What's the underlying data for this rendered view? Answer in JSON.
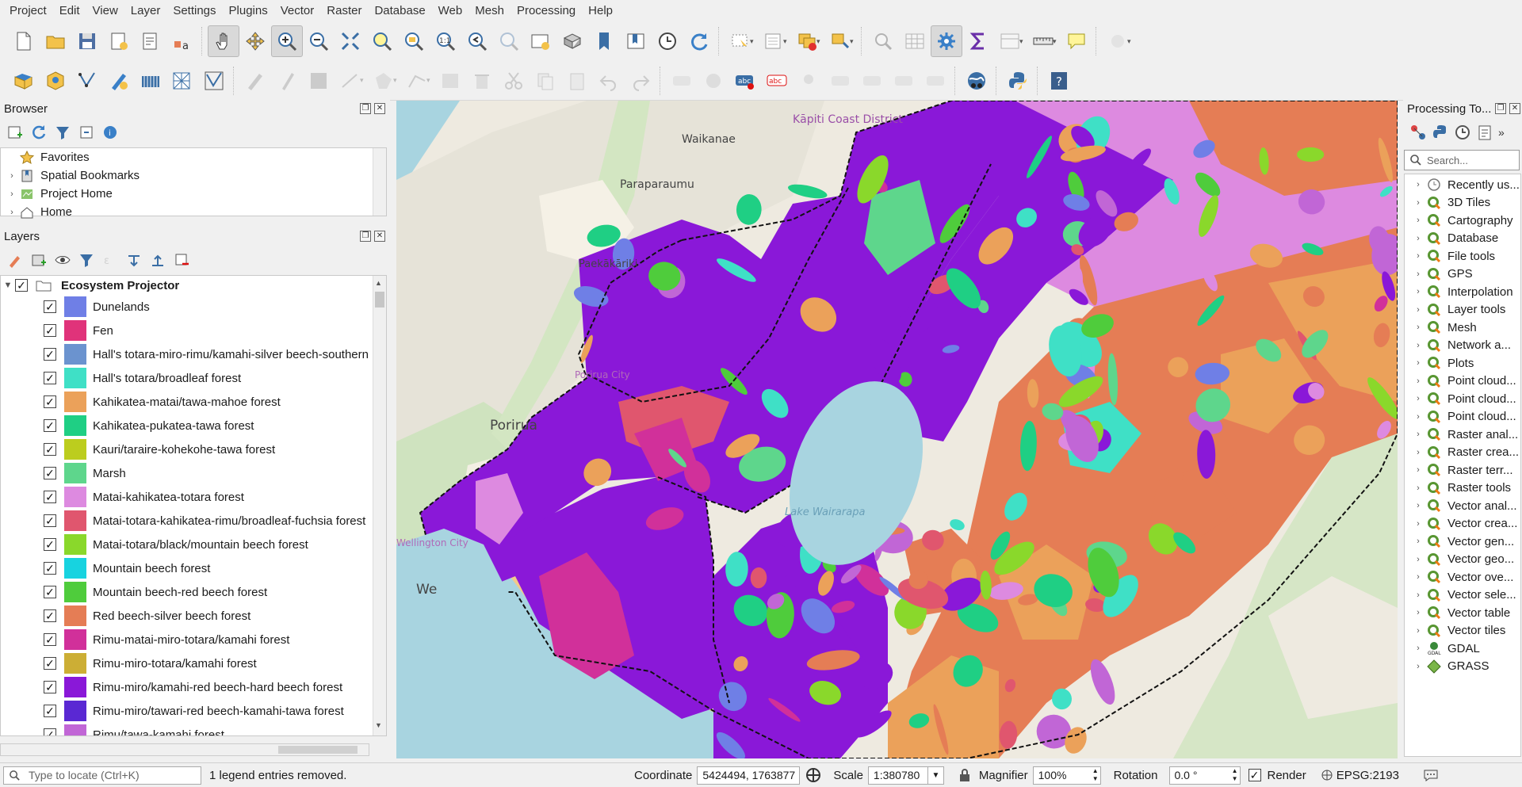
{
  "menu": [
    "Project",
    "Edit",
    "View",
    "Layer",
    "Settings",
    "Plugins",
    "Vector",
    "Raster",
    "Database",
    "Web",
    "Mesh",
    "Processing",
    "Help"
  ],
  "browser": {
    "title": "Browser",
    "items": [
      {
        "label": "Favorites",
        "icon": "star-icon"
      },
      {
        "label": "Spatial Bookmarks",
        "icon": "bookmark-icon"
      },
      {
        "label": "Project Home",
        "icon": "project-home-icon"
      },
      {
        "label": "Home",
        "icon": "home-icon"
      }
    ]
  },
  "layers": {
    "title": "Layers",
    "group": "Ecosystem Projector",
    "items": [
      {
        "label": "Dunelands",
        "color": "#6f7fe6"
      },
      {
        "label": "Fen",
        "color": "#e0337a"
      },
      {
        "label": "Hall's totara-miro-rimu/kamahi-silver beech-southern",
        "color": "#6b93cf"
      },
      {
        "label": "Hall's totara/broadleaf forest",
        "color": "#3fe0c6"
      },
      {
        "label": "Kahikatea-matai/tawa-mahoe forest",
        "color": "#eba15a"
      },
      {
        "label": "Kahikatea-pukatea-tawa forest",
        "color": "#1fcf84"
      },
      {
        "label": "Kauri/taraire-kohekohe-tawa forest",
        "color": "#bccd1e"
      },
      {
        "label": "Marsh",
        "color": "#5ed68c"
      },
      {
        "label": "Matai-kahikatea-totara forest",
        "color": "#dd8ae0"
      },
      {
        "label": "Matai-totara-kahikatea-rimu/broadleaf-fuchsia forest",
        "color": "#e0566e"
      },
      {
        "label": "Matai-totara/black/mountain beech forest",
        "color": "#8ad82b"
      },
      {
        "label": "Mountain beech forest",
        "color": "#17d3e0"
      },
      {
        "label": "Mountain beech-red beech forest",
        "color": "#4fcc3c"
      },
      {
        "label": "Red beech-silver beech forest",
        "color": "#e57d55"
      },
      {
        "label": "Rimu-matai-miro-totara/kamahi forest",
        "color": "#d1309a"
      },
      {
        "label": "Rimu-miro-totara/kamahi forest",
        "color": "#ccae35"
      },
      {
        "label": "Rimu-miro/kamahi-red beech-hard beech forest",
        "color": "#8a18d8"
      },
      {
        "label": "Rimu-miro/tawari-red beech-kamahi-tawa forest",
        "color": "#5a28d3"
      },
      {
        "label": "Rimu/tawa-kamahi forest",
        "color": "#c166d6"
      }
    ]
  },
  "map": {
    "labels": [
      "Kāpiti Coast District",
      "Waikanae",
      "Paraparaumu",
      "Paekākāriki",
      "Porirua",
      "Porirua City",
      "Wellington City",
      "Lake Wairarapa",
      "We"
    ]
  },
  "processing": {
    "title": "Processing To...",
    "search_placeholder": "Search...",
    "items": [
      "Recently us...",
      "3D Tiles",
      "Cartography",
      "Database",
      "File tools",
      "GPS",
      "Interpolation",
      "Layer tools",
      "Mesh",
      "Network a...",
      "Plots",
      "Point cloud...",
      "Point cloud...",
      "Point cloud...",
      "Raster anal...",
      "Raster crea...",
      "Raster terr...",
      "Raster tools",
      "Vector anal...",
      "Vector crea...",
      "Vector gen...",
      "Vector geo...",
      "Vector ove...",
      "Vector sele...",
      "Vector table",
      "Vector tiles",
      "GDAL",
      "GRASS"
    ]
  },
  "status": {
    "locate_placeholder": "Type to locate (Ctrl+K)",
    "message": "1 legend entries removed.",
    "coordinate_label": "Coordinate",
    "coordinate": "5424494, 1763877",
    "scale_label": "Scale",
    "scale": "1:380780",
    "magnifier_label": "Magnifier",
    "magnifier": "100%",
    "rotation_label": "Rotation",
    "rotation": "0.0 °",
    "render_label": "Render",
    "crs": "EPSG:2193"
  }
}
